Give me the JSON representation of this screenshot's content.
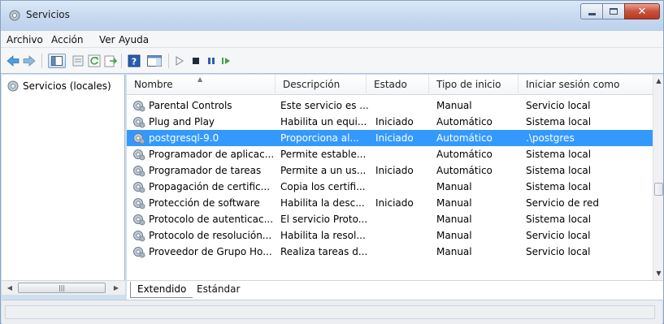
{
  "window": {
    "title": "Servicios"
  },
  "menu": [
    "Archivo",
    "Acción",
    "Ver",
    "Ayuda"
  ],
  "toolbar": {
    "icons": [
      "back-icon",
      "forward-icon",
      "console-tree-icon",
      "properties-icon",
      "refresh-icon",
      "export-icon",
      "help-icon",
      "show-hide-icon",
      "start-icon",
      "stop-icon",
      "pause-icon",
      "restart-icon"
    ]
  },
  "tree": {
    "label": "Servicios (locales)"
  },
  "table": {
    "headers": [
      "Nombre",
      "Descripción",
      "Estado",
      "Tipo de inicio",
      "Iniciar sesión como"
    ],
    "rows": [
      [
        "Parental Controls",
        "Este servicio es ...",
        "",
        "Manual",
        "Servicio local"
      ],
      [
        "Plug and Play",
        "Habilita un equi...",
        "Iniciado",
        "Automático",
        "Sistema local"
      ],
      [
        "postgresql-9.0",
        "Proporciona al...",
        "Iniciado",
        "Automático",
        ".\\postgres"
      ],
      [
        "Programador de aplicac...",
        "Permite estable...",
        "",
        "Automático",
        "Sistema local"
      ],
      [
        "Programador de tareas",
        "Permite a un us...",
        "Iniciado",
        "Automático",
        "Sistema local"
      ],
      [
        "Propagación de certific...",
        "Copia los certifi...",
        "",
        "Manual",
        "Sistema local"
      ],
      [
        "Protección de software",
        "Habilita la desc...",
        "Iniciado",
        "Manual",
        "Servicio de red"
      ],
      [
        "Protocolo de autenticac...",
        "El servicio Proto...",
        "",
        "Manual",
        "Sistema local"
      ],
      [
        "Protocolo de resolución...",
        "Habilita la resol...",
        "",
        "Manual",
        "Servicio local"
      ],
      [
        "Proveedor de Grupo Ho...",
        "Realiza tareas d...",
        "",
        "Manual",
        "Servicio local"
      ]
    ],
    "selected_row": 2
  },
  "tabs": [
    "Extendido",
    "Estándar"
  ],
  "colors": {
    "selection": "#3399ff",
    "titlebar": "#c9daf0",
    "close_button": "#c9513b"
  }
}
